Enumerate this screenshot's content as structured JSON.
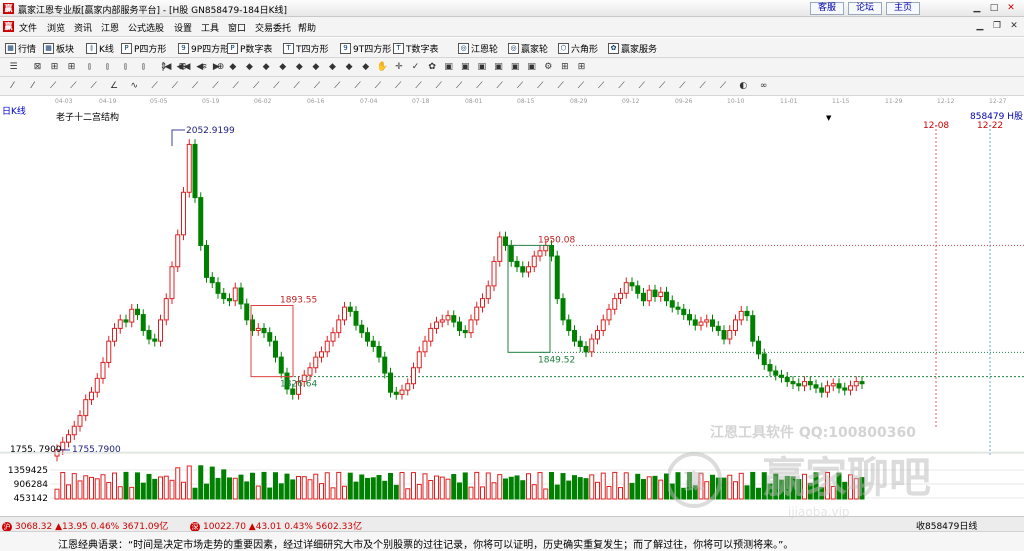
{
  "window": {
    "app_icon": "赢",
    "title": "赢家江恩专业版[赢家内部服务平台] - [H股 GN858479-184日K线]",
    "links": [
      "客服",
      "论坛",
      "主页"
    ]
  },
  "menu": [
    "文件",
    "浏览",
    "资讯",
    "江恩",
    "公式选股",
    "设置",
    "工具",
    "窗口",
    "交易委托",
    "帮助"
  ],
  "toolbar1": [
    {
      "icon": "grid-icon",
      "glyph": "▦",
      "label": "行情"
    },
    {
      "icon": "blocks-icon",
      "glyph": "▦",
      "label": "板块"
    },
    {
      "icon": "kline-icon",
      "glyph": "⫾",
      "label": "K线"
    },
    {
      "icon": "p-square-icon",
      "glyph": "P",
      "label": "P四方形"
    },
    {
      "icon": "9p-square-icon",
      "glyph": "9",
      "label": "9P四方形"
    },
    {
      "icon": "p-digit-icon",
      "glyph": "P",
      "label": "P数字表"
    },
    {
      "icon": "t-square-icon",
      "glyph": "T",
      "label": "T四方形"
    },
    {
      "icon": "9t-square-icon",
      "glyph": "9",
      "label": "9T四方形"
    },
    {
      "icon": "t-digit-icon",
      "glyph": "T",
      "label": "T数字表"
    },
    {
      "icon": "wheel-icon",
      "glyph": "◎",
      "label": "江恩轮"
    },
    {
      "icon": "winner-wheel-icon",
      "glyph": "◎",
      "label": "赢家轮"
    },
    {
      "icon": "hexagon-icon",
      "glyph": "⬡",
      "label": "六角形"
    },
    {
      "icon": "service-icon",
      "glyph": "✿",
      "label": "赢家服务"
    }
  ],
  "chart": {
    "period_label": "日K线",
    "structure_label": "老子十二宫结构",
    "dropdown_glyph": "▼",
    "code_label": "858479 H股",
    "date_marker_1": "12-08",
    "date_marker_2": "12-22",
    "axis_dates": [
      "04-03",
      "04-19",
      "05-05",
      "05-19",
      "06-02",
      "06-16",
      "07-04",
      "07-18",
      "08-01",
      "08-15",
      "08-29",
      "09-12",
      "09-26",
      "10-10",
      "11-01",
      "11-15",
      "11-29",
      "12-12",
      "12-27"
    ],
    "annotations": {
      "high_left": "2052.9199",
      "low_left": "1755.7900",
      "low_left_axis": "1755. 7900",
      "box1_high": "1893.55",
      "box1_low": "1826.64",
      "box2_high": "1950.08",
      "box2_low": "1849.52"
    },
    "volume_axis": [
      "1359425",
      "906284",
      "453142"
    ]
  },
  "chart_data": {
    "type": "candlestick",
    "price_range": [
      1755.79,
      2052.92
    ],
    "levels": {
      "high": 2052.9199,
      "low": 1755.79,
      "box1_high": 1893.55,
      "box1_low": 1826.64,
      "box2_high": 1950.08,
      "box2_low": 1849.52
    },
    "volume_ticks": [
      1359425,
      906284,
      453142
    ],
    "series_note": ""
  },
  "statusbar": {
    "sh": "3068.32 ▲13.95 0.46% 3671.09亿",
    "sz": "10022.70 ▲43.01 0.43% 5602.33亿",
    "right": "收858479日线"
  },
  "quote": "江恩经典语录：“时间是决定市场走势的重要因素，经过详细研究大市及个别股票的过往记录，你将可以证明，历史确实重复发生；而了解过往，你将可以预测将来。”。",
  "watermark": {
    "line1": "江恩工具软件  QQ:100800360",
    "line2": "赢家聊吧",
    "line3": "ijiaoba.vip",
    "badge": "赢"
  }
}
